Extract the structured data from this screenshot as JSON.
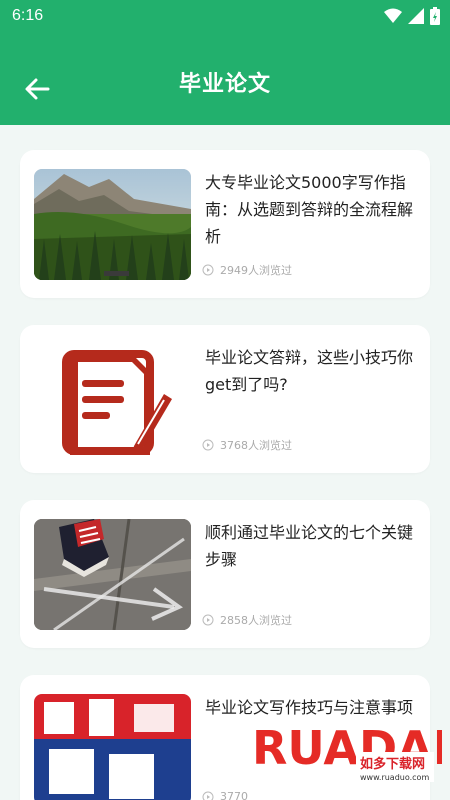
{
  "status": {
    "time": "6:16"
  },
  "header": {
    "title": "毕业论文"
  },
  "articles": [
    {
      "title": "大专毕业论文5000字写作指南：从选题到答辩的全流程解析",
      "views": "2949人浏览过"
    },
    {
      "title": "毕业论文答辩，这些小技巧你get到了吗?",
      "views": "3768人浏览过"
    },
    {
      "title": "顺利通过毕业论文的七个关键步骤",
      "views": "2858人浏览过"
    },
    {
      "title": "毕业论文写作技巧与注意事项",
      "views": "3770"
    }
  ],
  "watermark": {
    "brand": "RUADADO",
    "sub": "如多下载网",
    "url": "www.ruaduo.com"
  },
  "colors": {
    "primary": "#22b06d",
    "background": "#f1f7f5"
  }
}
